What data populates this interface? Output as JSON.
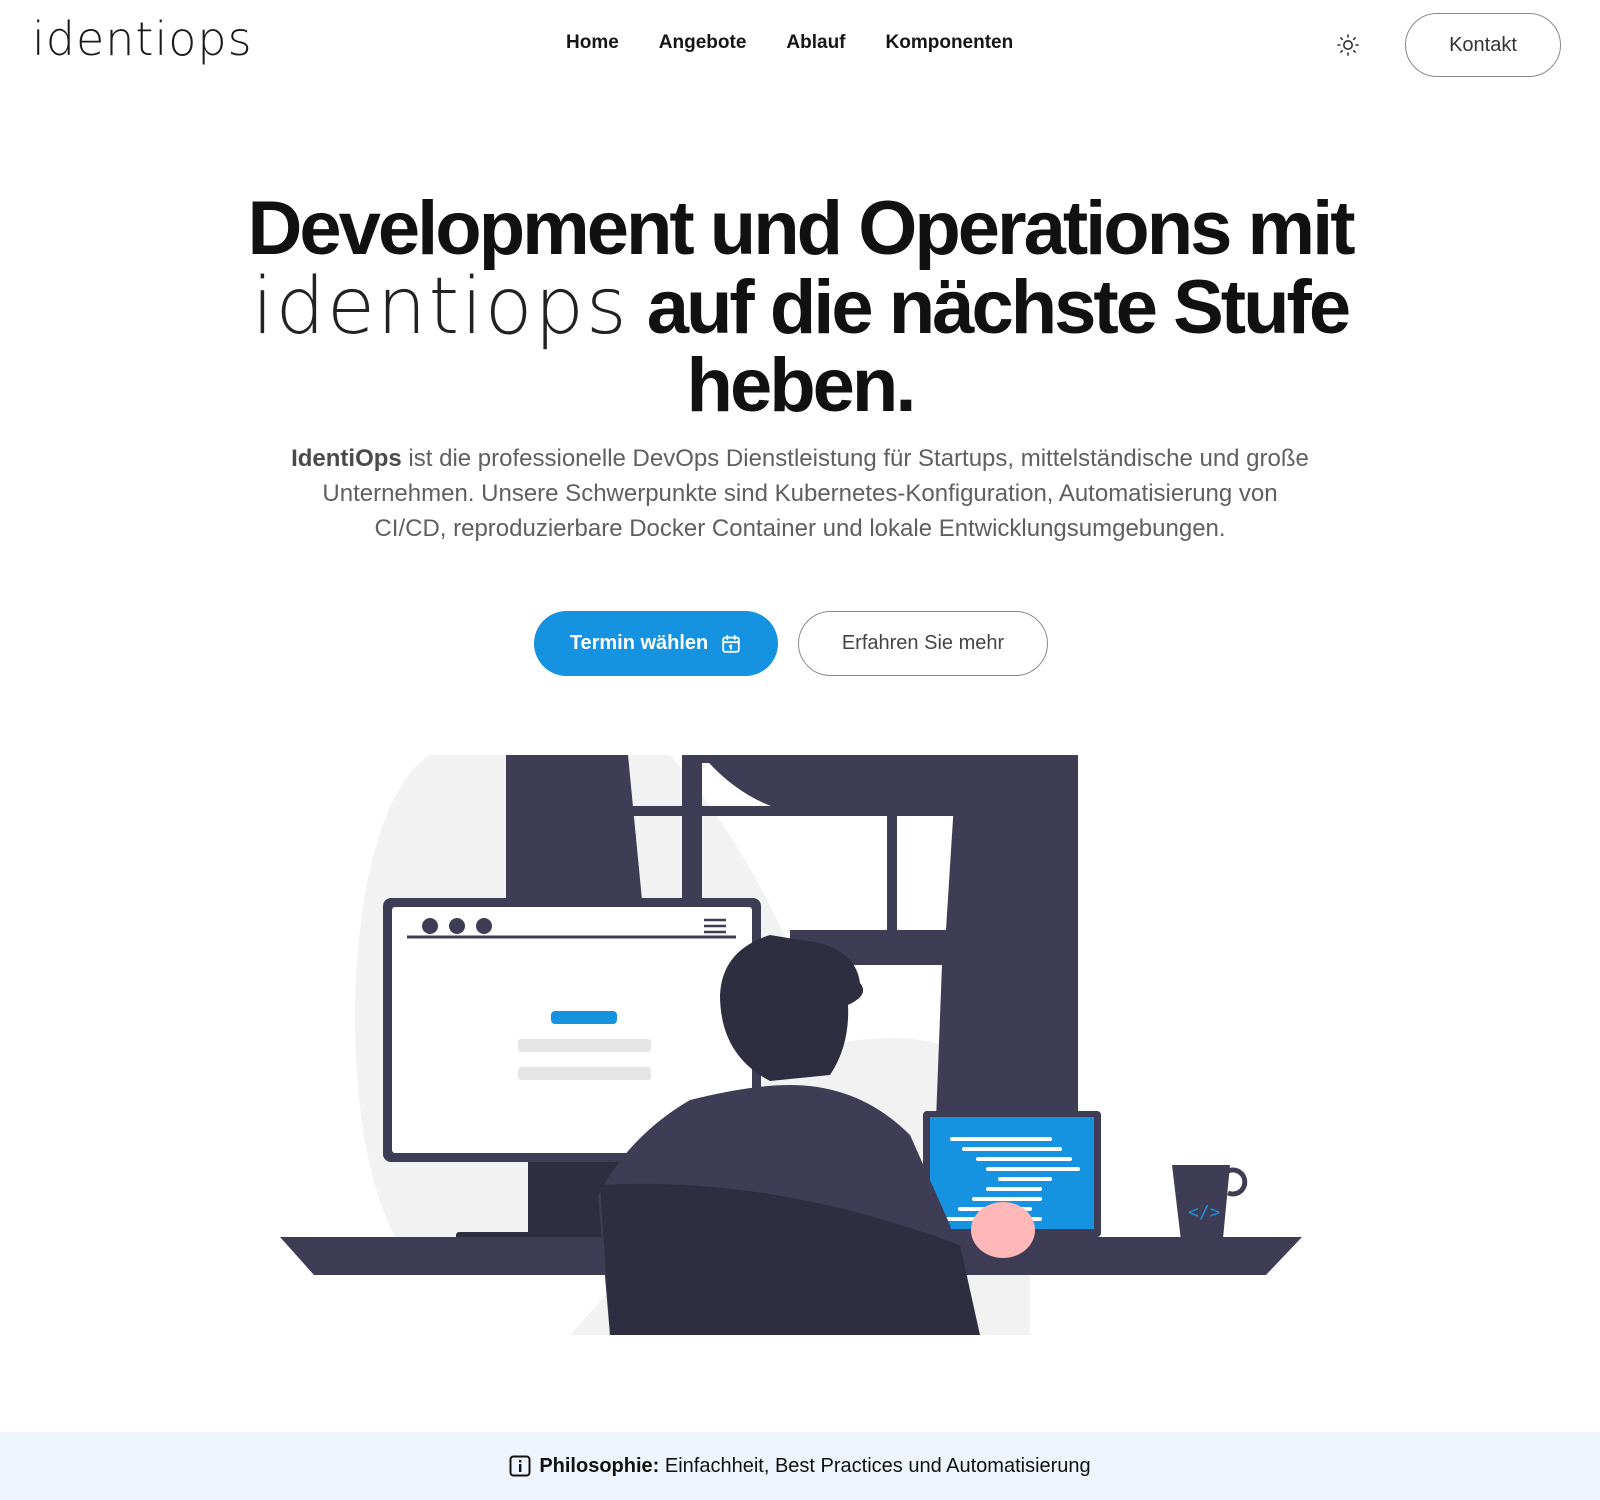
{
  "header": {
    "logo_text": "identiops",
    "nav": [
      "Home",
      "Angebote",
      "Ablauf",
      "Komponenten"
    ],
    "theme_icon": "sun-icon",
    "contact_label": "Kontakt"
  },
  "hero": {
    "title_line1": "Development und Operations mit",
    "title_logo": "identiops",
    "title_line2_rest": "auf die nächste Stufe",
    "title_line3": "heben.",
    "subtitle_brand": "IdentiOps",
    "subtitle_rest": " ist die professionelle DevOps Dienstleistung für Startups, mittelständische und große Unternehmen. Unsere Schwerpunkte sind Kubernetes-Konfiguration, Automatisierung von CI/CD, reproduzierbare Docker Container und lokale Entwicklungsumgebungen.",
    "cta_primary": "Termin wählen",
    "cta_primary_icon": "calendar-icon",
    "cta_secondary": "Erfahren Sie mehr"
  },
  "banner": {
    "icon": "info-icon",
    "label": "Philosophie:",
    "text": " Einfachheit, Best Practices und Automatisierung"
  },
  "colors": {
    "accent": "#1592e0",
    "dark": "#3f3d56",
    "banner_bg": "#eef5fd"
  }
}
